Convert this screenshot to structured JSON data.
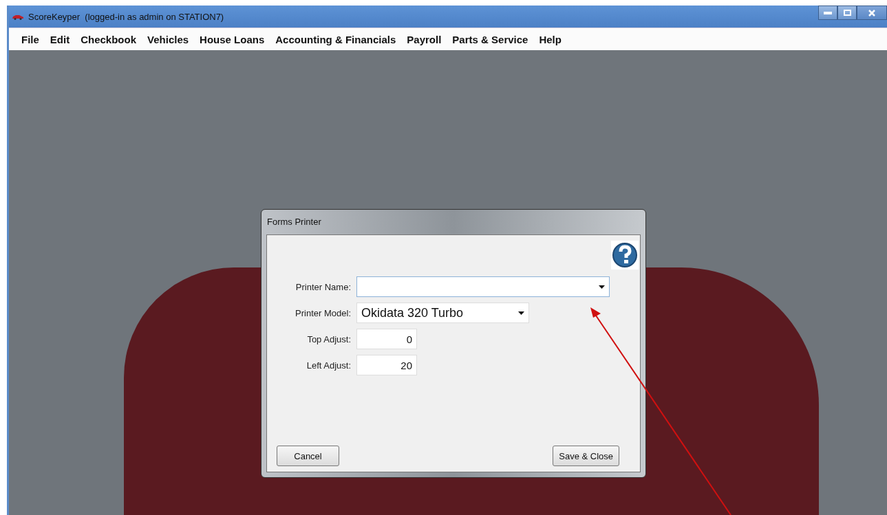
{
  "window": {
    "title": "ScoreKeyper  (logged-in as admin on STATION7)"
  },
  "menu": [
    "File",
    "Edit",
    "Checkbook",
    "Vehicles",
    "House Loans",
    "Accounting & Financials",
    "Payroll",
    "Parts & Service",
    "Help"
  ],
  "dialog": {
    "title": "Forms Printer",
    "fields": [
      {
        "kind": "combo",
        "label": "Printer Name:",
        "focused": true
      },
      {
        "kind": "combo",
        "label": "Printer Model:",
        "value": "Okidata 320 Turbo",
        "focused": false
      },
      {
        "kind": "number",
        "label": "Top Adjust:",
        "value": "0",
        "focused": false
      },
      {
        "kind": "number",
        "label": "Left Adjust:",
        "value": "20",
        "focused": false
      }
    ],
    "buttons": [
      "Cancel",
      "Save & Close"
    ]
  }
}
